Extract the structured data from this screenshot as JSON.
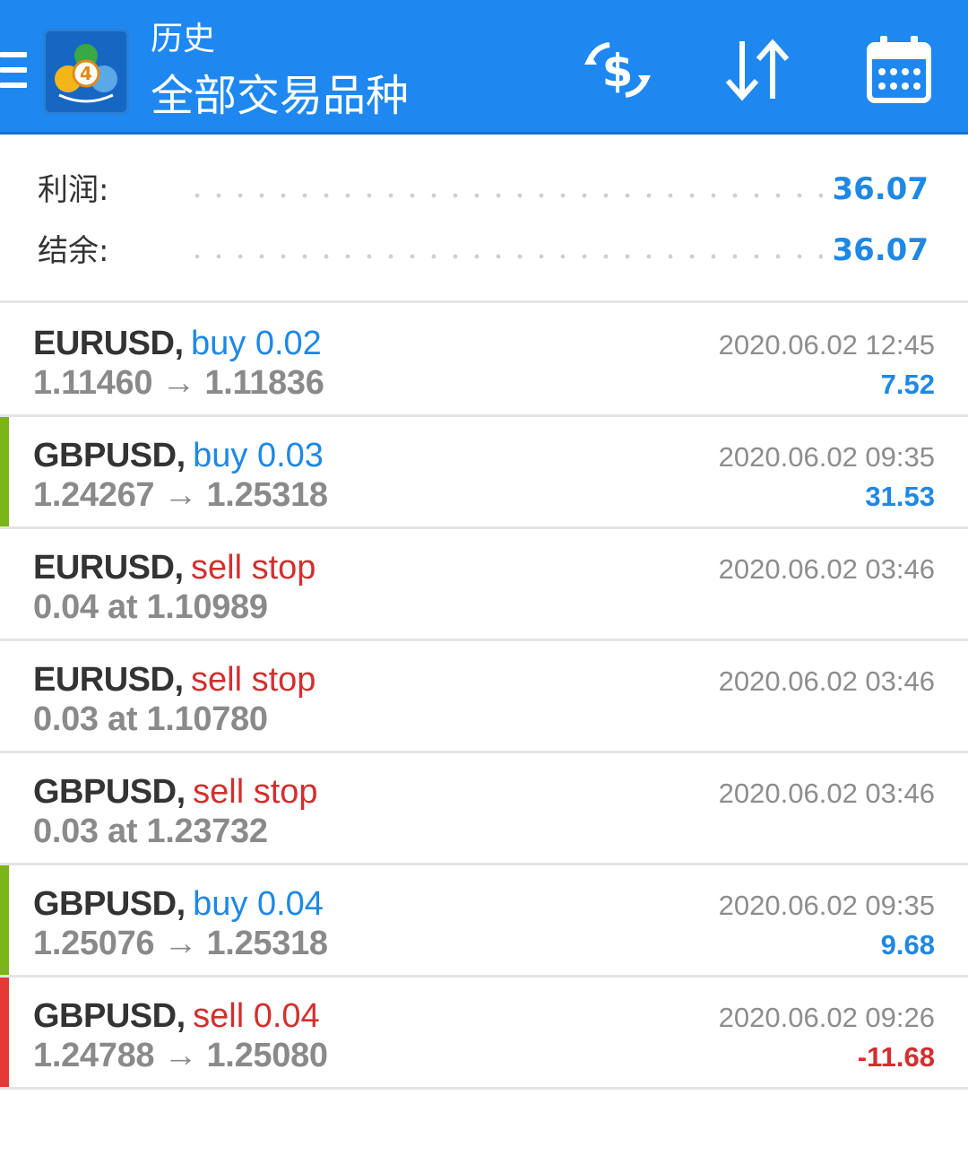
{
  "colors": {
    "header_bg": "#1e88f0",
    "blue": "#1e88e5",
    "red": "#d32f2f",
    "green_stripe": "#7cb518",
    "red_stripe": "#e53935",
    "dark_text": "#333333",
    "gray_text": "#8a8a8a"
  },
  "header": {
    "subtitle": "历史",
    "title": "全部交易品种",
    "menu_icon": "hamburger-menu-icon",
    "logo_icon": "metatrader4-logo-icon",
    "actions": [
      {
        "name": "currency-exchange-icon"
      },
      {
        "name": "sort-icon"
      },
      {
        "name": "calendar-icon"
      }
    ]
  },
  "summary": {
    "profit_label": "利润:",
    "profit_value": "36.07",
    "balance_label": "结余:",
    "balance_value": "36.07"
  },
  "trades": [
    {
      "symbol": "EURUSD",
      "comma": ",",
      "side_text": "buy 0.02",
      "side": "buy",
      "line2": "1.11460 → 1.11836",
      "date": "2020.06.02 12:45",
      "profit": "7.52",
      "profit_sign": "positive",
      "stripe": "none"
    },
    {
      "symbol": "GBPUSD",
      "comma": ",",
      "side_text": "buy 0.03",
      "side": "buy",
      "line2": "1.24267 → 1.25318",
      "date": "2020.06.02 09:35",
      "profit": "31.53",
      "profit_sign": "positive",
      "stripe": "green"
    },
    {
      "symbol": "EURUSD",
      "comma": ",",
      "side_text": "sell stop",
      "side": "sell",
      "line2": "0.04 at 1.10989",
      "date": "2020.06.02 03:46",
      "profit": "",
      "profit_sign": "none",
      "stripe": "none"
    },
    {
      "symbol": "EURUSD",
      "comma": ",",
      "side_text": "sell stop",
      "side": "sell",
      "line2": "0.03 at 1.10780",
      "date": "2020.06.02 03:46",
      "profit": "",
      "profit_sign": "none",
      "stripe": "none"
    },
    {
      "symbol": "GBPUSD",
      "comma": ",",
      "side_text": "sell stop",
      "side": "sell",
      "line2": "0.03 at 1.23732",
      "date": "2020.06.02 03:46",
      "profit": "",
      "profit_sign": "none",
      "stripe": "none"
    },
    {
      "symbol": "GBPUSD",
      "comma": ",",
      "side_text": "buy 0.04",
      "side": "buy",
      "line2": "1.25076 → 1.25318",
      "date": "2020.06.02 09:35",
      "profit": "9.68",
      "profit_sign": "positive",
      "stripe": "green"
    },
    {
      "symbol": "GBPUSD",
      "comma": ",",
      "side_text": "sell 0.04",
      "side": "sell",
      "line2": "1.24788 → 1.25080",
      "date": "2020.06.02 09:26",
      "profit": "-11.68",
      "profit_sign": "negative",
      "stripe": "red"
    }
  ]
}
